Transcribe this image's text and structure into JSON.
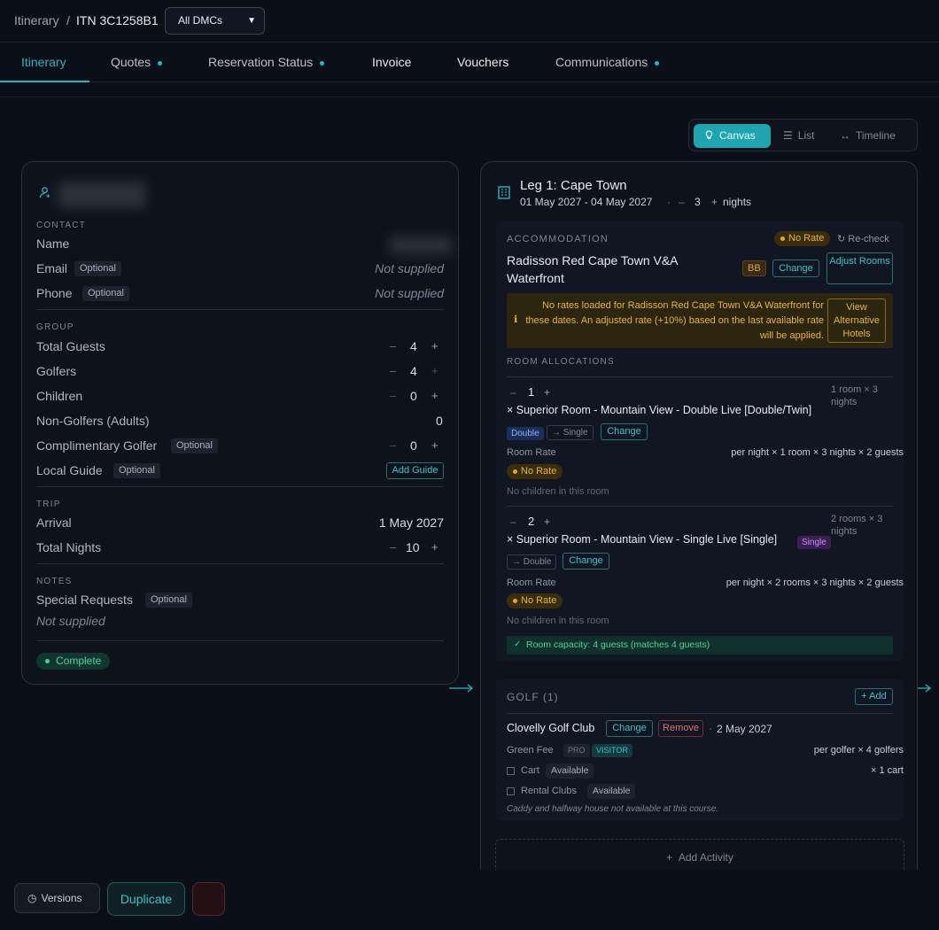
{
  "breadcrumb": {
    "root": "Itinerary",
    "sep": "/",
    "current": "ITN 3C1258B1"
  },
  "dmc_select": {
    "value": "All DMCs"
  },
  "tabs": [
    {
      "label": "Itinerary",
      "active": true,
      "dot": false
    },
    {
      "label": "Quotes",
      "dot": true
    },
    {
      "label": "Reservation Status",
      "dot": true
    },
    {
      "label": "Invoice",
      "dot": false
    },
    {
      "label": "Vouchers",
      "dot": false
    },
    {
      "label": "Communications",
      "dot": true
    }
  ],
  "view_switch": {
    "canvas": "Canvas",
    "list": "List",
    "timeline": "Timeline",
    "selected": "Canvas"
  },
  "client": {
    "contact_title": "CONTACT",
    "name_label": "Name",
    "email_label": "Email",
    "phone_label": "Phone",
    "optional": "Optional",
    "not_supplied": "Not supplied",
    "group_title": "GROUP",
    "total_guests_label": "Total Guests",
    "total_guests": "4",
    "golfers_label": "Golfers",
    "golfers": "4",
    "children_label": "Children",
    "children": "0",
    "non_golfers_label": "Non-Golfers (Adults)",
    "non_golfers": "0",
    "comp_golfer_label": "Complimentary Golfer",
    "comp_golfer": "0",
    "local_guide_label": "Local Guide",
    "add_guide": "Add Guide",
    "trip_title": "TRIP",
    "arrival_label": "Arrival",
    "arrival": "1 May 2027",
    "nights_label": "Total Nights",
    "nights": "10",
    "notes_title": "NOTES",
    "special_label": "Special Requests",
    "status": "Complete"
  },
  "leg": {
    "title": "Leg 1: Cape Town",
    "dates": "01 May 2027 - 04 May 2027",
    "dot": "·",
    "nights": "3",
    "nights_unit": "nights",
    "accommodation": {
      "title": "ACCOMMODATION",
      "no_rate": "No Rate",
      "recheck": "Re-check",
      "hotel": "Radisson Red Cape Town V&A Waterfront",
      "board": "BB",
      "change": "Change",
      "adjust": "Adjust Rooms",
      "warning": "No rates loaded for Radisson Red Cape Town V&A Waterfront for these dates. An adjusted rate (+10%) based on the last available rate will be applied.",
      "alt_btn": "View Alternative Hotels",
      "room_alloc_title": "ROOM ALLOCATIONS",
      "rooms": [
        {
          "qty": "1",
          "summary": "1 room × 3 nights",
          "name": "× Superior Room - Mountain View - Double Live [Double/Twin]",
          "tag1": "Double",
          "tag2": "→ Single",
          "change": "Change",
          "rate_label": "Room Rate",
          "rate_calc": "per night × 1 room × 3 nights × 2 guests",
          "no_rate": "No Rate",
          "children": "No children in this room"
        },
        {
          "qty": "2",
          "summary": "2 rooms × 3 nights",
          "name": "× Superior Room - Mountain View - Single Live [Single]",
          "tag1": "Single",
          "tag2": "→ Double",
          "change": "Change",
          "rate_label": "Room Rate",
          "rate_calc": "per night × 2 rooms × 3 nights × 2 guests",
          "no_rate": "No Rate",
          "children": "No children in this room"
        }
      ],
      "capacity": "Room capacity: 4 guests (matches 4 guests)"
    },
    "golf": {
      "title": "GOLF (1)",
      "add": "+ Add",
      "course": "Clovelly Golf Club",
      "change": "Change",
      "remove": "Remove",
      "date": "2 May 2027",
      "green_fee": "Green Fee",
      "pro": "PRO",
      "visitor": "VISITOR",
      "fee_calc": "per golfer × 4 golfers",
      "cart": "Cart",
      "cart_avail": "Available",
      "cart_qty": "× 1 cart",
      "clubs": "Rental Clubs",
      "clubs_avail": "Available",
      "note": "Caddy and halfway house not available at this course."
    },
    "add_activity": "Add Activity"
  },
  "footer": {
    "versions": "Versions",
    "duplicate": "Duplicate"
  }
}
